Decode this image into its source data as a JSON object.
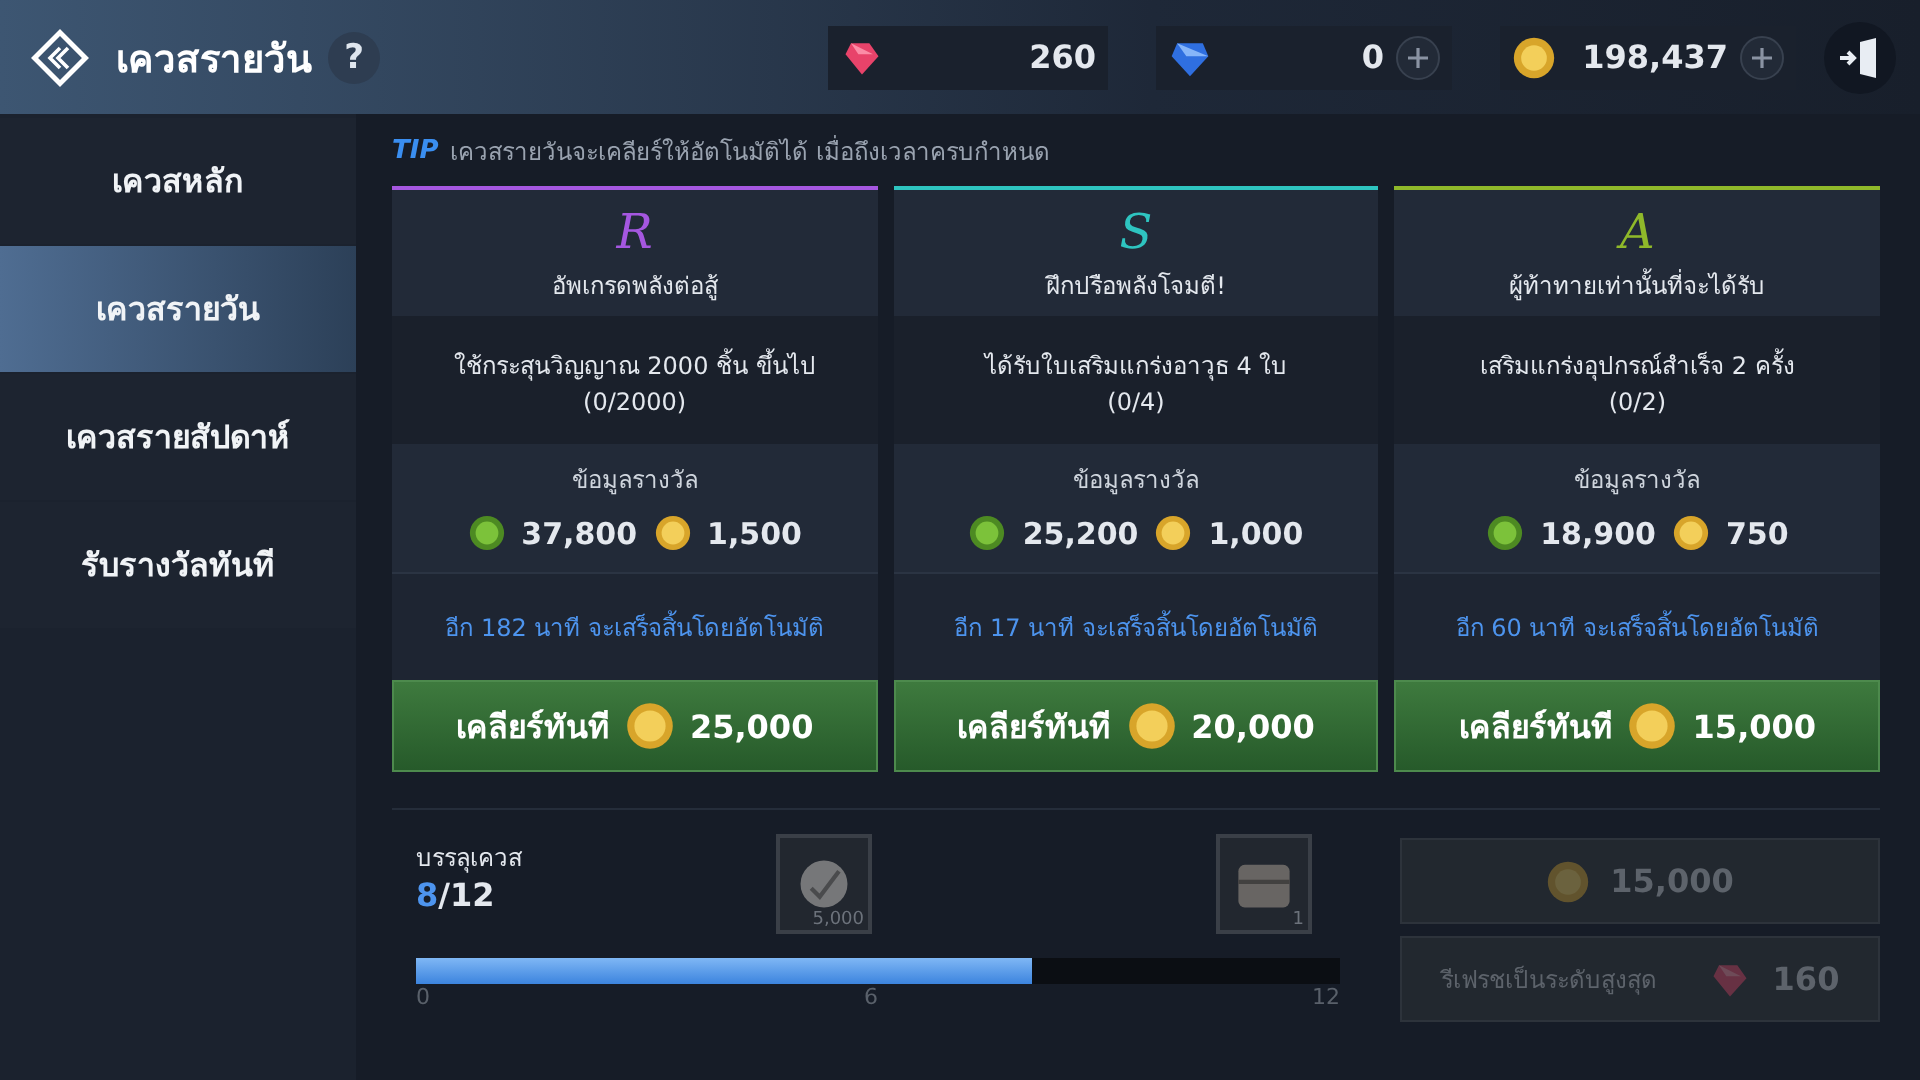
{
  "header": {
    "title": "เควสรายวัน",
    "help": "?",
    "currencies": [
      {
        "kind": "ruby",
        "amount": "260",
        "plus": false
      },
      {
        "kind": "sapphire",
        "amount": "0",
        "plus": true
      },
      {
        "kind": "gold",
        "amount": "198,437",
        "plus": true
      }
    ]
  },
  "sidebar": {
    "items": [
      {
        "label": "เควสหลัก",
        "selected": false
      },
      {
        "label": "เควสรายวัน",
        "selected": true
      },
      {
        "label": "เควสรายสัปดาห์",
        "selected": false
      },
      {
        "label": "รับรางวัลทันที",
        "selected": false
      }
    ]
  },
  "tip": {
    "label": "TIP",
    "text": "เควสรายวันจะเคลียร์ให้อัตโนมัติได้ เมื่อถึงเวลาครบกำหนด"
  },
  "quests": [
    {
      "grade": "R",
      "color": "#a557e0",
      "title": "อัพเกรดพลังต่อสู้",
      "condition": "ใช้กระสุนวิญญาณ 2000 ชิ้น ขึ้นไป",
      "progress": "(0/2000)",
      "reward_label": "ข้อมูลรางวัล",
      "exp": "37,800",
      "gold": "1,500",
      "timer": "อีก 182 นาที จะเสร็จสิ้นโดยอัตโนมัติ",
      "button_label": "เคลียร์ทันที",
      "cost": "25,000"
    },
    {
      "grade": "S",
      "color": "#2ec4c0",
      "title": "ฝึกปรือพลังโจมตี!",
      "condition": "ได้รับใบเสริมแกร่งอาวุธ 4 ใบ",
      "progress": "(0/4)",
      "reward_label": "ข้อมูลรางวัล",
      "exp": "25,200",
      "gold": "1,000",
      "timer": "อีก 17 นาที จะเสร็จสิ้นโดยอัตโนมัติ",
      "button_label": "เคลียร์ทันที",
      "cost": "20,000"
    },
    {
      "grade": "A",
      "color": "#8fb82a",
      "title": "ผู้ท้าทายเท่านั้นที่จะได้รับ",
      "condition": "เสริมแกร่งอุปกรณ์สำเร็จ 2 ครั้ง",
      "progress": "(0/2)",
      "reward_label": "ข้อมูลรางวัล",
      "exp": "18,900",
      "gold": "750",
      "timer": "อีก 60 นาที จะเสร็จสิ้นโดยอัตโนมัติ",
      "button_label": "เคลียร์ทันที",
      "cost": "15,000"
    }
  ],
  "achievement": {
    "label": "บรรลุเควส",
    "done": "8",
    "total": "/12",
    "level": 0.667,
    "ticks": [
      "0",
      "6",
      "12"
    ],
    "rewards": [
      {
        "kind": "stone",
        "count": "5,000"
      },
      {
        "kind": "chest",
        "count": "1"
      }
    ]
  },
  "actions": [
    {
      "kind": "gold",
      "amount": "15,000",
      "disabled": true
    },
    {
      "kind": "ruby",
      "label": "รีเฟรชเป็นระดับสูงสุด",
      "amount": "160",
      "disabled": true
    }
  ]
}
